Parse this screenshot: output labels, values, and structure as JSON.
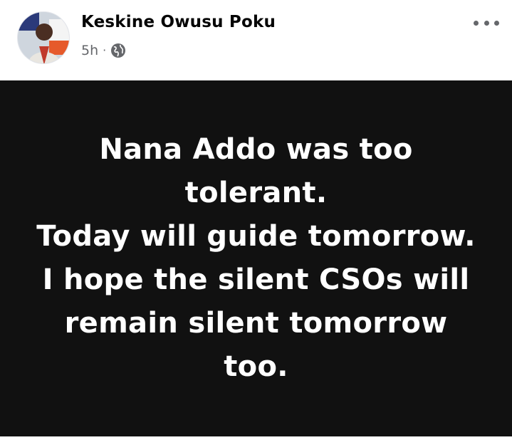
{
  "post": {
    "author": "Keskine Owusu Poku",
    "time": "5h",
    "separator": "·",
    "audience_icon": "globe-icon",
    "more_icon": "more-options-icon",
    "text_lines": [
      "Nana Addo was too",
      "tolerant.",
      "Today will guide tomorrow.",
      "I hope the silent CSOs will",
      "remain silent tomorrow",
      "too."
    ],
    "card_background": "#111111",
    "card_text_color": "#ffffff"
  }
}
